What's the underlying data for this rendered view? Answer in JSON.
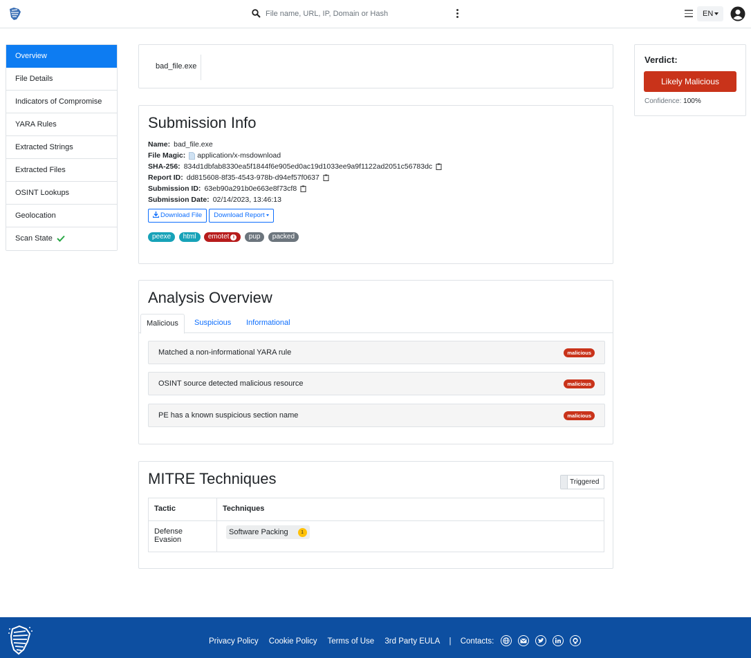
{
  "topbar": {
    "search_placeholder": "File name, URL, IP, Domain or Hash",
    "language": "EN"
  },
  "sidebar": {
    "items": [
      {
        "label": "Overview",
        "active": true
      },
      {
        "label": "File Details"
      },
      {
        "label": "Indicators of Compromise"
      },
      {
        "label": "YARA Rules"
      },
      {
        "label": "Extracted Strings"
      },
      {
        "label": "Extracted Files"
      },
      {
        "label": "OSINT Lookups"
      },
      {
        "label": "Geolocation"
      },
      {
        "label": "Scan State"
      }
    ]
  },
  "file_tab": {
    "label": "bad_file.exe"
  },
  "verdict": {
    "title": "Verdict:",
    "value": "Likely Malicious",
    "confidence_label": "Confidence:",
    "confidence_value": "100%",
    "color": "#c9331a"
  },
  "submission": {
    "title": "Submission Info",
    "name_label": "Name:",
    "name": "bad_file.exe",
    "magic_label": "File Magic:",
    "magic": "application/x-msdownload",
    "sha_label": "SHA-256:",
    "sha": "834d1dbfab8330ea5f1844f6e905ed0ac19d1033ee9a9f1122ad2051c56783dc",
    "report_label": "Report ID:",
    "report_id": "dd815608-8f35-4543-978b-d94ef57f0637",
    "submission_label": "Submission ID:",
    "submission_id": "63eb90a291b0e663e8f73cf8",
    "date_label": "Submission Date:",
    "date": "02/14/2023, 13:46:13",
    "download_file": "Download File",
    "download_report": "Download Report",
    "tags": [
      "peexe",
      "html",
      "emotet",
      "pup",
      "packed"
    ]
  },
  "analysis": {
    "title": "Analysis Overview",
    "tabs": [
      "Malicious",
      "Suspicious",
      "Informational"
    ],
    "findings": [
      {
        "text": "Matched a non-informational YARA rule",
        "badge": "malicious"
      },
      {
        "text": "OSINT source detected malicious resource",
        "badge": "malicious"
      },
      {
        "text": "PE has a known suspicious section name",
        "badge": "malicious"
      }
    ]
  },
  "mitre": {
    "title": "MITRE Techniques",
    "toggle_label": "Triggered",
    "headers": [
      "Tactic",
      "Techniques"
    ],
    "rows": [
      {
        "tactic": "Defense Evasion",
        "technique": "Software Packing",
        "count": "1"
      }
    ]
  },
  "footer": {
    "links": [
      "Privacy Policy",
      "Cookie Policy",
      "Terms of Use",
      "3rd Party EULA"
    ],
    "separator": "|",
    "contacts_label": "Contacts:",
    "bg_color": "#0d4fa1"
  }
}
